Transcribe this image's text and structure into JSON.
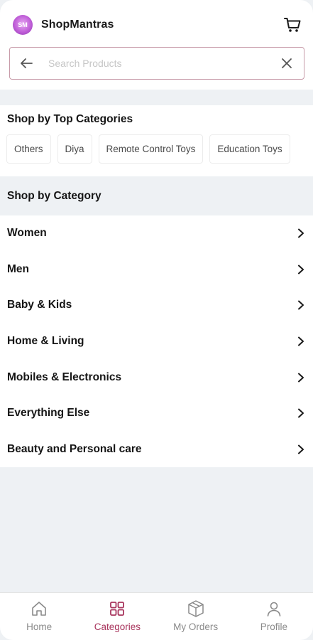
{
  "header": {
    "logo_text": "SM",
    "app_name": "ShopMantras",
    "cart_icon": "cart-icon"
  },
  "search": {
    "placeholder": "Search Products",
    "value": "",
    "back_icon": "arrow-left-icon",
    "clear_icon": "close-icon"
  },
  "top_categories": {
    "title": "Shop by Top Categories",
    "chips": [
      "Others",
      "Diya",
      "Remote Control Toys",
      "Education Toys"
    ]
  },
  "categories": {
    "title": "Shop by Category",
    "items": [
      {
        "label": "Women"
      },
      {
        "label": "Men"
      },
      {
        "label": "Baby & Kids"
      },
      {
        "label": "Home & Living"
      },
      {
        "label": "Mobiles & Electronics"
      },
      {
        "label": "Everything Else"
      },
      {
        "label": "Beauty and Personal care"
      }
    ]
  },
  "bottom_nav": {
    "items": [
      {
        "label": "Home",
        "icon": "home-icon",
        "active": false
      },
      {
        "label": "Categories",
        "icon": "grid-icon",
        "active": true
      },
      {
        "label": "My Orders",
        "icon": "box-icon",
        "active": false
      },
      {
        "label": "Profile",
        "icon": "user-icon",
        "active": false
      }
    ]
  },
  "colors": {
    "accent": "#a8345c",
    "search_border": "#c79aa8",
    "background": "#eef1f4",
    "inactive_nav": "#8a8a8a"
  }
}
